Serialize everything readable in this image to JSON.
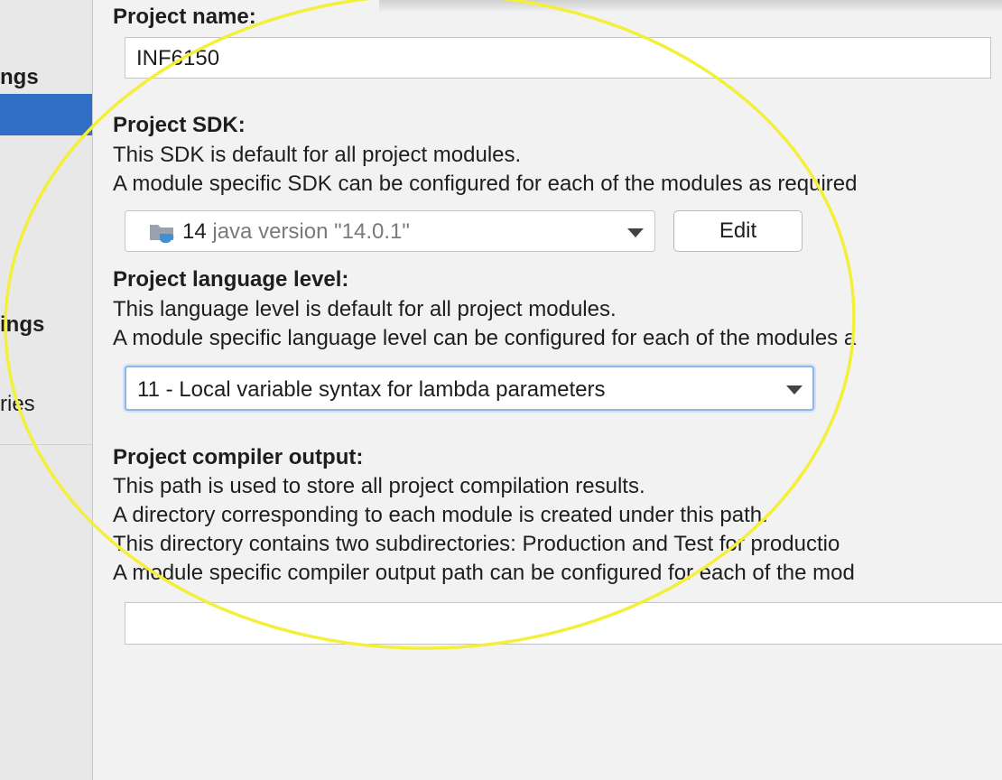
{
  "sidebar": {
    "items": [
      {
        "label": "ngs"
      },
      {
        "label": "ings"
      },
      {
        "label": "ries"
      }
    ]
  },
  "project_name": {
    "heading": "Project name:",
    "value": "INF6150"
  },
  "project_sdk": {
    "heading": "Project SDK:",
    "line1": "This SDK is default for all project modules.",
    "line2": "A module specific SDK can be configured for each of the modules as required",
    "selected_version": "14",
    "selected_detail": "java version \"14.0.1\"",
    "edit_label": "Edit"
  },
  "language_level": {
    "heading": "Project language level:",
    "line1": "This language level is default for all project modules.",
    "line2": "A module specific language level can be configured for each of the modules a",
    "selected": "11 - Local variable syntax for lambda parameters"
  },
  "compiler_output": {
    "heading": "Project compiler output:",
    "line1": "This path is used to store all project compilation results.",
    "line2": "A directory corresponding to each module is created under this path.",
    "line3": "This directory contains two subdirectories: Production and Test for productio",
    "line4": "A module specific compiler output path can be configured for each of the mod",
    "path_value": ""
  },
  "annotation": {
    "color": "#f3ef3a"
  },
  "icons": {
    "sdk": "jdk-folder-icon",
    "dropdown": "chevron-down-icon"
  }
}
